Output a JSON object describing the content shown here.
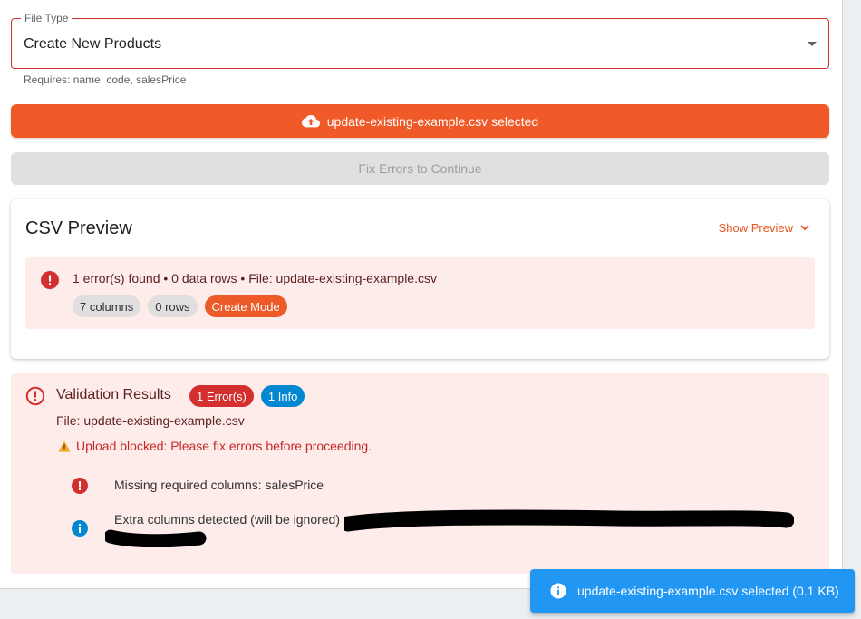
{
  "form": {
    "file_type_label": "File Type",
    "file_type_value": "Create New Products",
    "helper_text": "Requires: name, code, salesPrice"
  },
  "actions": {
    "upload_label": "update-existing-example.csv selected",
    "continue_label": "Fix Errors to Continue"
  },
  "preview": {
    "title": "CSV Preview",
    "toggle_label": "Show Preview",
    "summary": "1 error(s) found • 0 data rows • File: update-existing-example.csv",
    "chips": [
      "7 columns",
      "0 rows",
      "Create Mode"
    ]
  },
  "validation": {
    "title": "Validation Results",
    "error_badge": "1 Error(s)",
    "info_badge": "1 Info",
    "file_line": "File: update-existing-example.csv",
    "warning": "Upload blocked: Please fix errors before proceeding.",
    "issues": [
      {
        "type": "error",
        "text": "Missing required columns: salesPrice"
      },
      {
        "type": "info",
        "text": "Extra columns detected (will be ignored)"
      }
    ]
  },
  "snackbar": {
    "text": "update-existing-example.csv selected (0.1 KB)"
  },
  "colors": {
    "accent": "#f05a28",
    "error": "#d32f2f",
    "info": "#0288d1",
    "alert_bg": "#fdecea",
    "snackbar": "#2196f3"
  }
}
